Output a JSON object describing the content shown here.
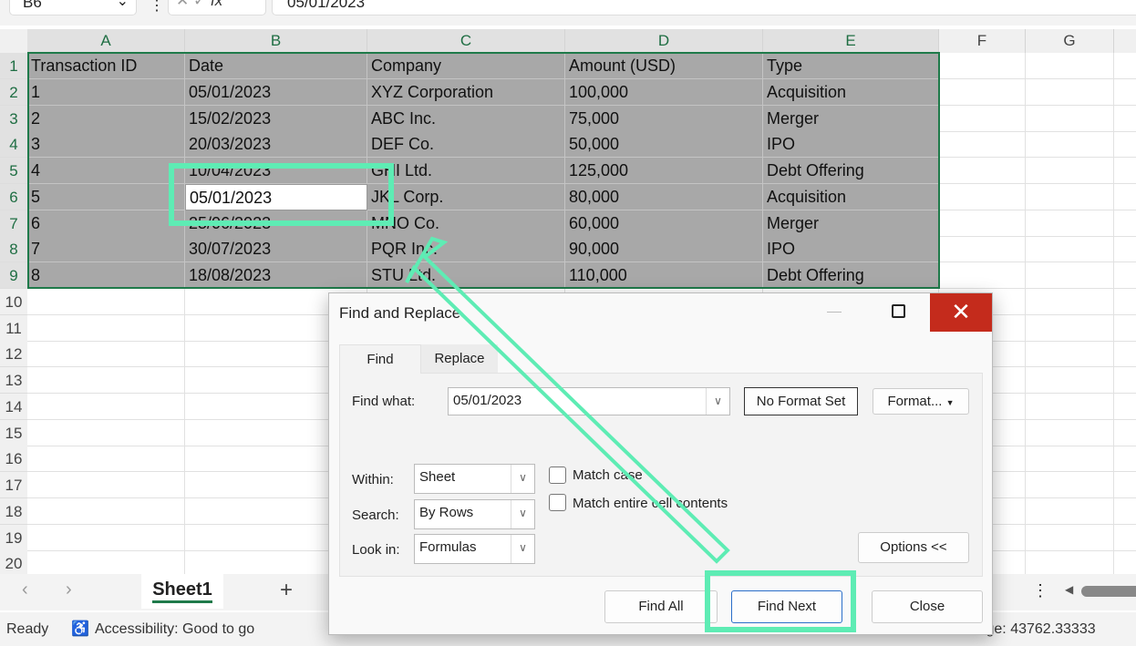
{
  "formula_bar": {
    "name_box": "B6",
    "fx": "fx",
    "value": "05/01/2023"
  },
  "columns": [
    "A",
    "B",
    "C",
    "D",
    "E",
    "F",
    "G"
  ],
  "rows": [
    "1",
    "2",
    "3",
    "4",
    "5",
    "6",
    "7",
    "8",
    "9",
    "10",
    "11",
    "12",
    "13",
    "14",
    "15",
    "16",
    "17",
    "18",
    "19",
    "20"
  ],
  "table": {
    "headers": [
      "Transaction ID",
      "Date",
      "Company",
      "Amount (USD)",
      "Type"
    ],
    "rows": [
      [
        "1",
        "05/01/2023",
        "XYZ Corporation",
        "100,000",
        "Acquisition"
      ],
      [
        "2",
        "15/02/2023",
        "ABC Inc.",
        "75,000",
        "Merger"
      ],
      [
        "3",
        "20/03/2023",
        "DEF Co.",
        "50,000",
        "IPO"
      ],
      [
        "4",
        "10/04/2023",
        "GHI Ltd.",
        "125,000",
        "Debt Offering"
      ],
      [
        "5",
        "05/01/2023",
        "JKL Corp.",
        "80,000",
        "Acquisition"
      ],
      [
        "6",
        "25/06/2023",
        "MNO Co.",
        "60,000",
        "Merger"
      ],
      [
        "7",
        "30/07/2023",
        "PQR Inc.",
        "90,000",
        "IPO"
      ],
      [
        "8",
        "18/08/2023",
        "STU Ltd.",
        "110,000",
        "Debt Offering"
      ]
    ]
  },
  "sheet_tabs": {
    "active": "Sheet1",
    "add": "+"
  },
  "status": {
    "ready": "Ready",
    "accessibility": "Accessibility: Good to go",
    "average": "Average: 43762.33333"
  },
  "dialog": {
    "title": "Find and Replace",
    "tabs": [
      "Find",
      "Replace"
    ],
    "find_what_label": "Find what:",
    "find_what_value": "05/01/2023",
    "no_format": "No Format Set",
    "format": "Format...",
    "within_label": "Within:",
    "within_value": "Sheet",
    "search_label": "Search:",
    "search_value": "By Rows",
    "lookin_label": "Look in:",
    "lookin_value": "Formulas",
    "match_case": "Match case",
    "match_entire": "Match entire cell contents",
    "options": "Options <<",
    "find_all": "Find All",
    "find_next": "Find Next",
    "close": "Close"
  },
  "colors": {
    "accent": "#1f7a4a",
    "highlight": "#5eecb4",
    "close_red": "#c42b1c"
  }
}
